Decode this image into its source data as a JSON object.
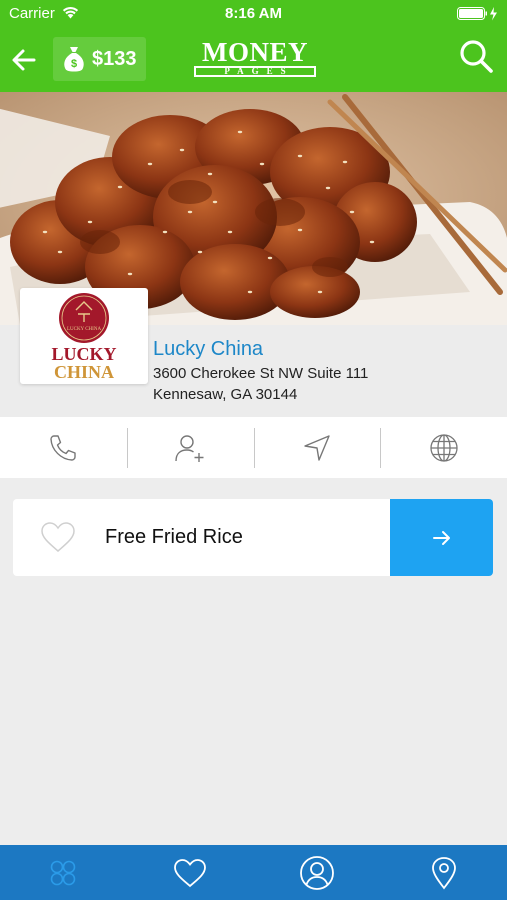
{
  "status_bar": {
    "carrier": "Carrier",
    "time": "8:16 AM"
  },
  "nav": {
    "wallet_amount": "$133",
    "logo_top": "MONEY",
    "logo_bottom": "PAGES"
  },
  "business": {
    "logo_line1": "LUCKY",
    "logo_line2": "CHINA",
    "logo_seal_text": "LUCKY CHINA",
    "name": "Lucky China",
    "address_line1": "3600 Cherokee St NW Suite 111",
    "address_line2": "Kennesaw, GA 30144"
  },
  "actions": [
    "phone-icon",
    "add-contact-icon",
    "directions-icon",
    "website-globe-icon"
  ],
  "offer": {
    "title": "Free Fried Rice"
  },
  "tabs": [
    "categories-icon",
    "favorites-heart-icon",
    "profile-icon",
    "location-pin-icon"
  ],
  "colors": {
    "header_green": "#4cc41e",
    "link_blue": "#1d87c8",
    "offer_button": "#1ea3f2",
    "tabbar_blue": "#1c78c2",
    "active_tab_icon": "#2b9be8"
  }
}
